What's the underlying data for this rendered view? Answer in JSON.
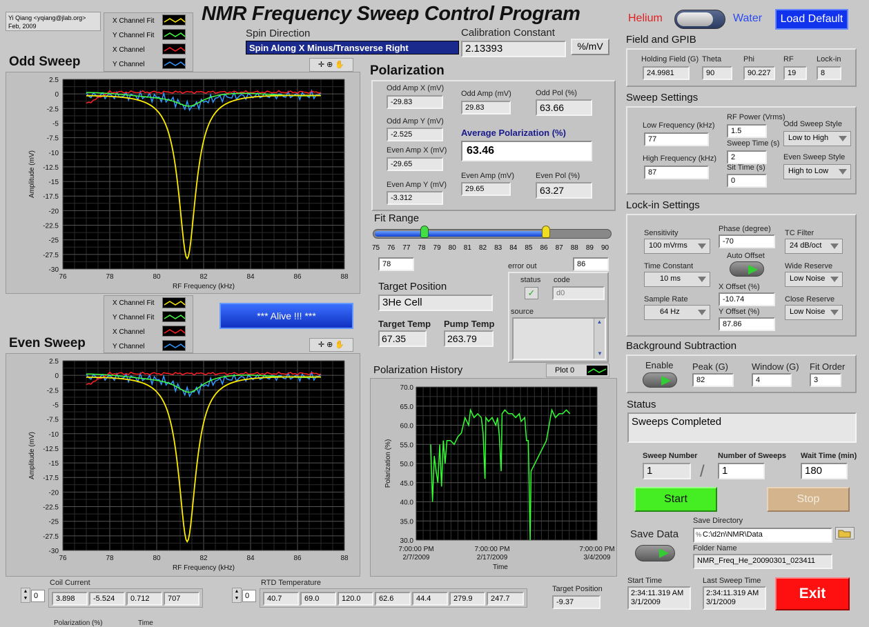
{
  "author": {
    "line1": "Yi Qiang <yqiang@jlab.org>",
    "line2": "Feb, 2009"
  },
  "app_title": "NMR Frequency Sweep Control Program",
  "helium_label": "Helium",
  "water_label": "Water",
  "load_default": "Load Default",
  "spin": {
    "label": "Spin Direction",
    "value": "Spin Along X Minus/Transverse Right"
  },
  "calib": {
    "label": "Calibration Constant",
    "value": "2.13393",
    "unit": "%/mV"
  },
  "legend_items": [
    "X Channel Fit",
    "Y Channel Fit",
    "X Channel",
    "Y Channel"
  ],
  "colors": {
    "x_fit": "#ffee00",
    "y_fit": "#44ff44",
    "x_ch": "#ff2020",
    "y_ch": "#3399ff",
    "history": "#33ff33"
  },
  "odd_sweep": {
    "title": "Odd Sweep"
  },
  "even_sweep": {
    "title": "Even Sweep"
  },
  "sweep_axes": {
    "xlabel": "RF Frequency (kHz)",
    "ylabel": "Amplitude (mV)",
    "xticks": [
      "76",
      "78",
      "80",
      "82",
      "84",
      "86",
      "88"
    ],
    "yticks": [
      "2.5",
      "0",
      "-2.5",
      "-5",
      "-7.5",
      "-10",
      "-12.5",
      "-15",
      "-17.5",
      "-20",
      "-22.5",
      "-25",
      "-27.5",
      "-30"
    ]
  },
  "alive": "*** Alive !!! ***",
  "polarization": {
    "title": "Polarization",
    "odd_amp_x_l": "Odd Amp X (mV)",
    "odd_amp_x": "-29.83",
    "odd_amp_y_l": "Odd Amp Y (mV)",
    "odd_amp_y": "-2.525",
    "even_amp_x_l": "Even Amp X (mV)",
    "even_amp_x": "-29.65",
    "even_amp_y_l": "Even Amp Y (mV)",
    "even_amp_y": "-3.312",
    "odd_amp_l": "Odd Amp (mV)",
    "odd_amp": "29.83",
    "odd_pol_l": "Odd Pol (%)",
    "odd_pol": "63.66",
    "avg_pol_l": "Average Polarization (%)",
    "avg_pol": "63.46",
    "even_amp_l": "Even Amp (mV)",
    "even_amp": "29.65",
    "even_pol_l": "Even Pol (%)",
    "even_pol": "63.27"
  },
  "fit_range": {
    "label": "Fit Range",
    "ticks": [
      "75",
      "76",
      "77",
      "78",
      "79",
      "80",
      "81",
      "82",
      "83",
      "84",
      "85",
      "86",
      "87",
      "88",
      "89",
      "90"
    ],
    "low": "78",
    "high": "86"
  },
  "error_out": {
    "label": "error out",
    "status": "status",
    "code": "code",
    "code_val": "d0",
    "source": "source",
    "check": "✓"
  },
  "target": {
    "pos_label": "Target Position",
    "pos_value": "3He Cell",
    "temp_label": "Target Temp",
    "temp": "67.35",
    "pump_label": "Pump Temp",
    "pump": "263.79"
  },
  "history": {
    "title": "Polarization History",
    "plot_label": "Plot 0",
    "ylabel": "Polarization (%)",
    "xlabel": "Time",
    "yticks": [
      "70.0",
      "65.0",
      "60.0",
      "55.0",
      "50.0",
      "45.0",
      "40.0",
      "35.0",
      "30.0"
    ],
    "xticks": [
      [
        "7:00:00 PM",
        "2/7/2009"
      ],
      [
        "7:00:00 PM",
        "2/17/2009"
      ],
      [
        "7:00:00 PM",
        "3/4/2009"
      ]
    ]
  },
  "field": {
    "title": "Field and GPIB",
    "hold_l": "Holding Field (G)",
    "hold": "24.9981",
    "theta_l": "Theta",
    "theta": "90",
    "phi_l": "Phi",
    "phi": "90.227",
    "rf_l": "RF",
    "rf": "19",
    "lockin_l": "Lock-in",
    "lockin": "8"
  },
  "sweep_settings": {
    "title": "Sweep Settings",
    "low_l": "Low Frequency (kHz)",
    "low": "77",
    "high_l": "High Frequency (kHz)",
    "high": "87",
    "rfp_l": "RF Power (Vrms)",
    "rfp": "1.5",
    "st_l": "Sweep Time (s)",
    "st": "2",
    "sit_l": "Sit Time (s)",
    "sit": "0",
    "odd_style_l": "Odd Sweep Style",
    "odd_style": "Low to High",
    "even_style_l": "Even Sweep Style",
    "even_style": "High to Low"
  },
  "lockin": {
    "title": "Lock-in Settings",
    "sens_l": "Sensitivity",
    "sens": "100 mVrms",
    "tc_l": "Time Constant",
    "tc": "10 ms",
    "sr_l": "Sample Rate",
    "sr": "64 Hz",
    "phase_l": "Phase (degree)",
    "phase": "-70",
    "auto_l": "Auto Offset",
    "xoff_l": "X Offset (%)",
    "xoff": "-10.74",
    "yoff_l": "Y Offset (%)",
    "yoff": "87.86",
    "tcf_l": "TC Filter",
    "tcf": "24 dB/oct",
    "wr_l": "Wide Reserve",
    "wr": "Low Noise",
    "cr_l": "Close Reserve",
    "cr": "Low Noise"
  },
  "bg": {
    "title": "Background Subtraction",
    "enable_l": "Enable",
    "peak_l": "Peak (G)",
    "peak": "82",
    "win_l": "Window (G)",
    "win": "4",
    "fo_l": "Fit Order",
    "fo": "3"
  },
  "status": {
    "title": "Status",
    "text": "Sweeps Completed"
  },
  "counts": {
    "sn_l": "Sweep Number",
    "sn": "1",
    "nos_l": "Number of Sweeps",
    "nos": "1",
    "wt_l": "Wait Time (min)",
    "wt": "180",
    "slash": "/"
  },
  "start": "Start",
  "stop": "Stop",
  "save": {
    "label": "Save Data",
    "dir_l": "Save Directory",
    "dir": "C:\\d2n\\NMR\\Data",
    "folder_l": "Folder Name",
    "folder": "NMR_Freq_He_20090301_023411",
    "path_icon": "%"
  },
  "times": {
    "start_l": "Start Time",
    "start1": "2:34:11.319 AM",
    "start2": "3/1/2009",
    "last_l": "Last Sweep Time",
    "last1": "2:34:11.319 AM",
    "last2": "3/1/2009"
  },
  "exit": "Exit",
  "coil": {
    "label": "Coil Current",
    "idx": "0",
    "values": [
      "3.898",
      "-5.524",
      "0.712",
      "707"
    ]
  },
  "rtd": {
    "label": "RTD Temperature",
    "idx": "0",
    "values": [
      "40.7",
      "69.0",
      "120.0",
      "62.6",
      "44.4",
      "279.9",
      "247.7"
    ]
  },
  "tpos": {
    "label": "Target Position",
    "value": "-9.37"
  },
  "bottom_cut": {
    "a": "Polarization (%)",
    "b": "Time"
  }
}
